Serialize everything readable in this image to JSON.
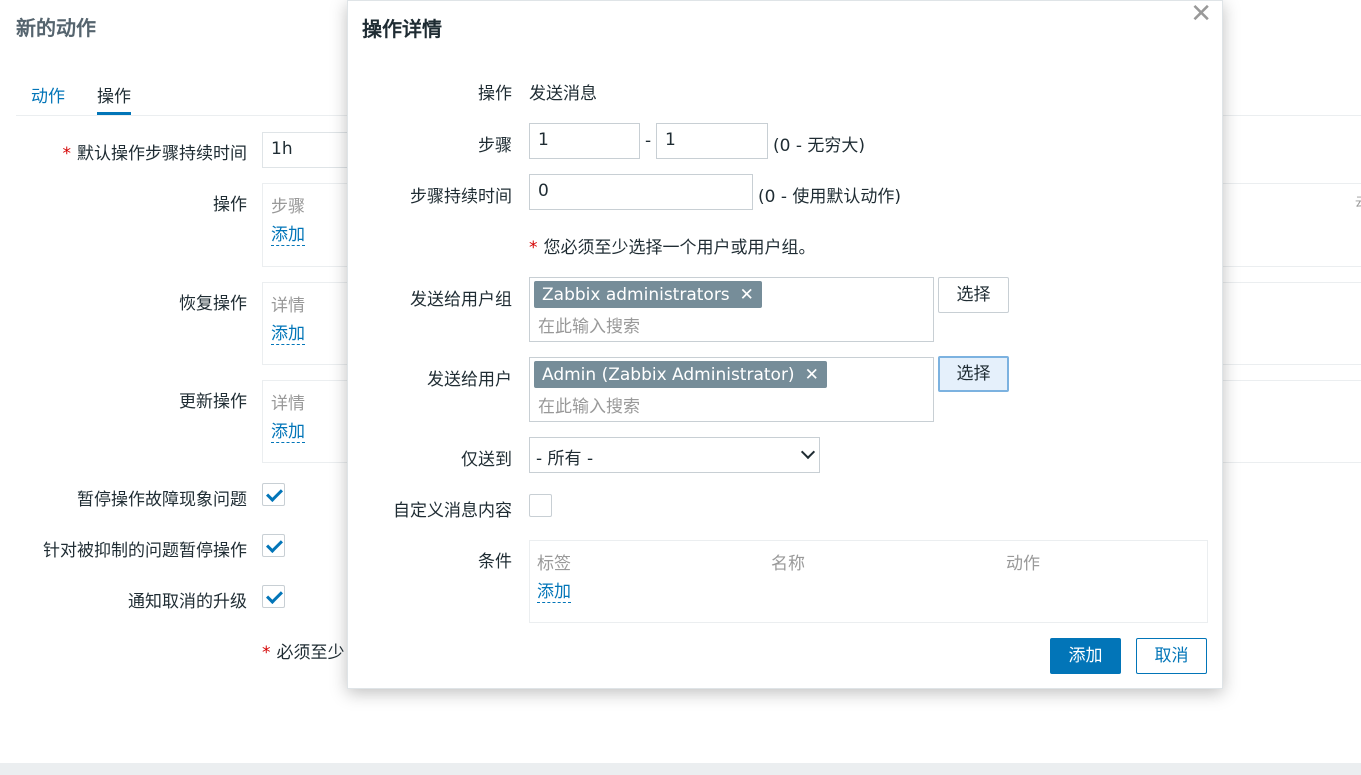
{
  "background": {
    "title": "新的动作",
    "tabs": [
      {
        "label": "动作",
        "active": false
      },
      {
        "label": "操作",
        "active": true
      }
    ],
    "default_step_duration": {
      "label": "默认操作步骤持续时间",
      "value": "1h",
      "required": true
    },
    "operations": {
      "label": "操作",
      "header": "步骤",
      "add": "添加"
    },
    "recovery_operations": {
      "label": "恢复操作",
      "header": "详情",
      "add": "添加"
    },
    "update_operations": {
      "label": "更新操作",
      "header": "详情",
      "add": "添加"
    },
    "pause_symptoms": {
      "label": "暂停操作故障现象问题",
      "checked": true
    },
    "pause_suppressed": {
      "label": "针对被抑制的问题暂停操作",
      "checked": true
    },
    "notify_cancelled": {
      "label": "通知取消的升级",
      "checked": true
    },
    "required_note": "必须至少",
    "edge_glyph": "云"
  },
  "dialog": {
    "title": "操作详情",
    "close_icon": "close-icon",
    "operation": {
      "label": "操作",
      "value": "发送消息"
    },
    "steps": {
      "label": "步骤",
      "from": "1",
      "separator": "-",
      "to": "1",
      "hint": "(0 - 无穷大)"
    },
    "step_duration": {
      "label": "步骤持续时间",
      "value": "0",
      "hint": "(0 - 使用默认动作)"
    },
    "required_message": "您必须至少选择一个用户或用户组。",
    "user_groups": {
      "label": "发送给用户组",
      "chip": "Zabbix administrators",
      "placeholder": "在此输入搜索",
      "select": "选择"
    },
    "users": {
      "label": "发送给用户",
      "chip": "Admin (Zabbix Administrator)",
      "placeholder": "在此输入搜索",
      "select": "选择"
    },
    "send_only_to": {
      "label": "仅送到",
      "value": "- 所有 -"
    },
    "custom_message": {
      "label": "自定义消息内容",
      "checked": false
    },
    "conditions": {
      "label": "条件",
      "columns": [
        "标签",
        "名称",
        "动作"
      ],
      "add": "添加"
    },
    "add_button": "添加",
    "cancel_button": "取消"
  },
  "colors": {
    "accent": "#0275b8",
    "chip": "#768d99",
    "required": "#d40000"
  }
}
